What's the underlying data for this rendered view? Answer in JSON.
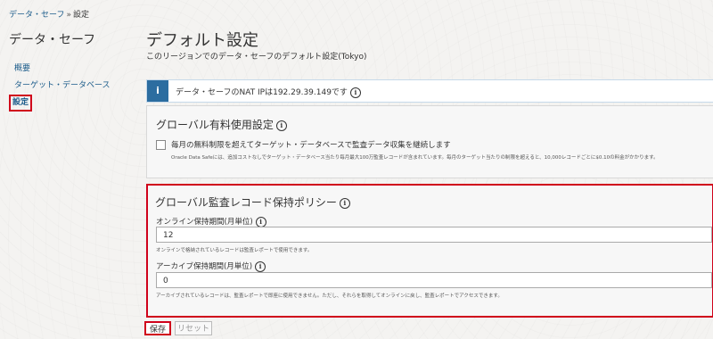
{
  "breadcrumb": {
    "root": "データ・セーフ",
    "sep": "»",
    "current": "設定"
  },
  "sidebar": {
    "title": "データ・セーフ",
    "items": [
      {
        "label": "概要"
      },
      {
        "label": "ターゲット・データベース"
      },
      {
        "label": "設定"
      }
    ]
  },
  "page": {
    "title": "デフォルト設定",
    "subtitle": "このリージョンでのデータ・セーフのデフォルト設定(Tokyo)"
  },
  "info_banner": {
    "icon": "i",
    "text": "データ・セーフのNAT IPは192.29.39.149です"
  },
  "paid_usage": {
    "title": "グローバル有料使用設定",
    "checkbox_label": "毎月の無料制限を超えてターゲット・データベースで監査データ収集を継続します",
    "checkbox_checked": false,
    "description": "Oracle Data Safeには、追加コストなしでターゲット・データベース当たり毎月最大100万監査レコードが含まれています。毎月のターゲット当たりの制限を超えると、10,000レコードごとに$0.10の料金がかかります。"
  },
  "retention": {
    "title": "グローバル監査レコード保持ポリシー",
    "online_label": "オンライン保持期間(月単位)",
    "online_value": "12",
    "online_hint": "オンラインで格納されているレコードは監査レポートで使用できます。",
    "archive_label": "アーカイブ保持期間(月単位)",
    "archive_value": "0",
    "archive_hint": "アーカイブされているレコードは、監査レポートで即座に使用できません。ただし、それらを取得してオンラインに戻し、監査レポートでアクセスできます。"
  },
  "buttons": {
    "save": "保存",
    "reset": "リセット"
  },
  "colors": {
    "accent": "#2c6da0",
    "highlight": "#d0021b",
    "link": "#1a5b8a"
  }
}
